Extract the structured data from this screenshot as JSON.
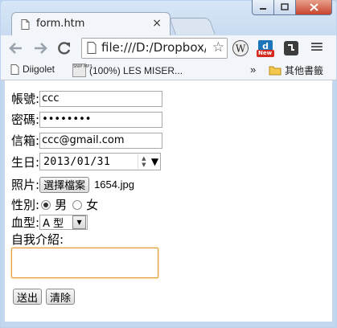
{
  "window": {
    "min_glyph": "–",
    "max_glyph": "□",
    "close_glyph": "✕"
  },
  "tab": {
    "title": "form.htm",
    "close_glyph": "×"
  },
  "toolbar": {
    "back_icon": "arrow-left-icon",
    "forward_icon": "arrow-right-icon",
    "reload_icon": "reload-icon",
    "url": "file:///D:/Dropbox/",
    "star_glyph": "☆",
    "menu_glyph": "≡",
    "new_badge": "New"
  },
  "bookmarks": {
    "item1": "Diigolet",
    "item2": "(100%) LES MISER...",
    "snip_text": "SNIP MP3",
    "overflow": "»",
    "other_folder": "其他書籤"
  },
  "form": {
    "account_label": "帳號:",
    "account_value": "ccc",
    "password_label": "密碼:",
    "password_value": "••••••••",
    "email_label": "信箱:",
    "email_value": "ccc@gmail.com",
    "birth_label": "生日:",
    "birth_value": "2013/01/31",
    "photo_label": "照片:",
    "photo_button": "選擇檔案",
    "photo_file": "1654.jpg",
    "gender_label": "性別:",
    "gender_male": "男",
    "gender_female": "女",
    "blood_label": "血型:",
    "blood_value": "A 型",
    "intro_label": "自我介紹:",
    "submit": "送出",
    "reset": "清除"
  },
  "colors": {
    "frame": "#bcd3ef",
    "focus_border": "#e39a30"
  }
}
